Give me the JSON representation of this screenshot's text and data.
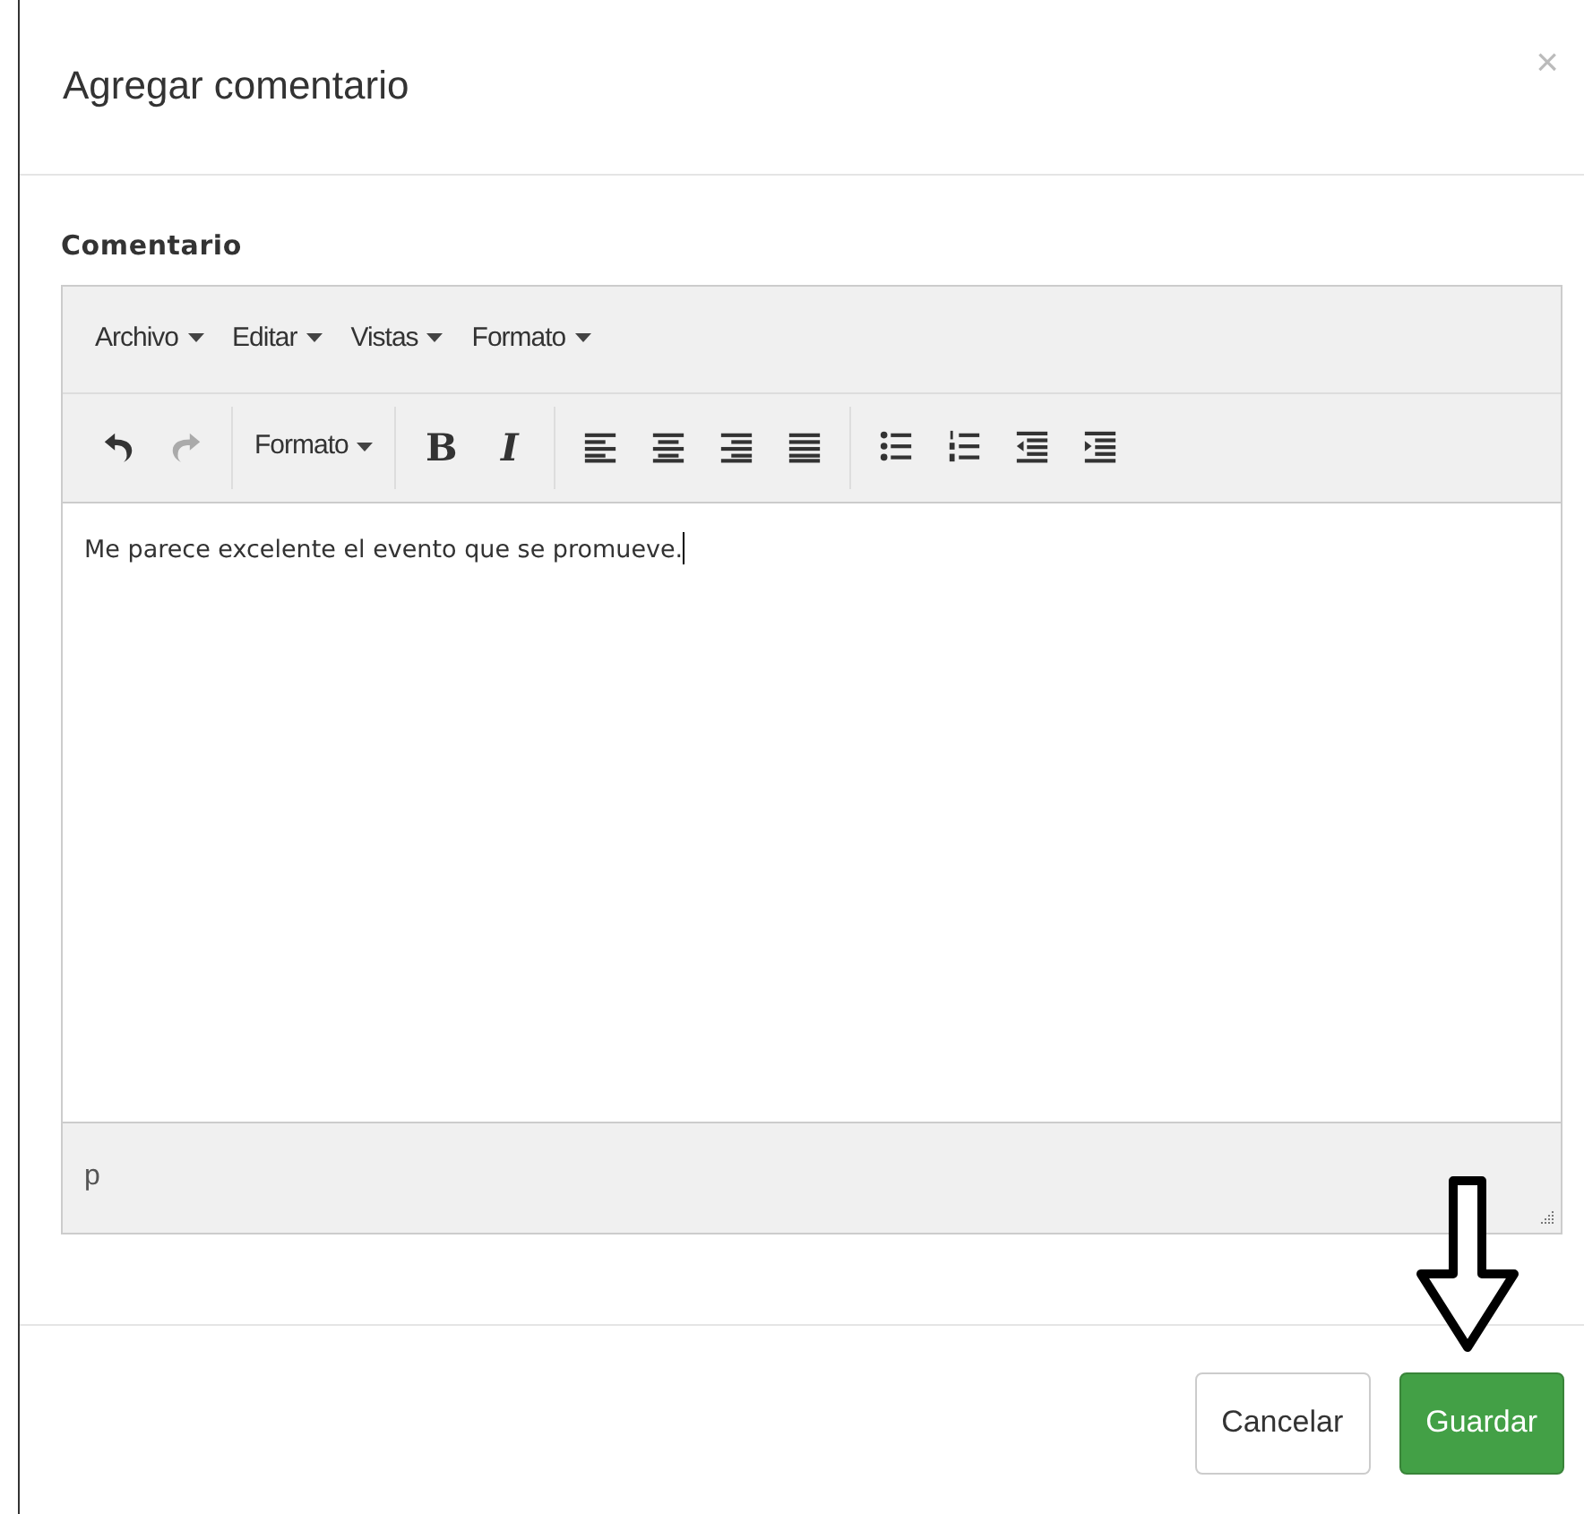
{
  "modal": {
    "title": "Agregar comentario",
    "close": "×"
  },
  "field_label": "Comentario",
  "editor": {
    "menus": [
      {
        "label": "Archivo"
      },
      {
        "label": "Editar"
      },
      {
        "label": "Vistas"
      },
      {
        "label": "Formato"
      }
    ],
    "toolbar_groups": [
      [
        {
          "kind": "undo",
          "disabled": false
        },
        {
          "kind": "redo",
          "disabled": true
        }
      ],
      [
        {
          "kind": "dropdown",
          "label": "Formato"
        }
      ],
      [
        {
          "kind": "bold",
          "label": "B"
        },
        {
          "kind": "italic",
          "label": "I"
        }
      ],
      [
        {
          "kind": "align-left"
        },
        {
          "kind": "align-center"
        },
        {
          "kind": "align-right"
        },
        {
          "kind": "justify"
        }
      ],
      [
        {
          "kind": "bullet-list"
        },
        {
          "kind": "numbered-list"
        },
        {
          "kind": "outdent"
        },
        {
          "kind": "indent"
        }
      ]
    ],
    "content": "Me parece excelente el evento que se promueve.",
    "path": "p"
  },
  "buttons": [
    {
      "label": "Cancelar",
      "kind": "default"
    },
    {
      "label": "Guardar",
      "kind": "success"
    }
  ]
}
